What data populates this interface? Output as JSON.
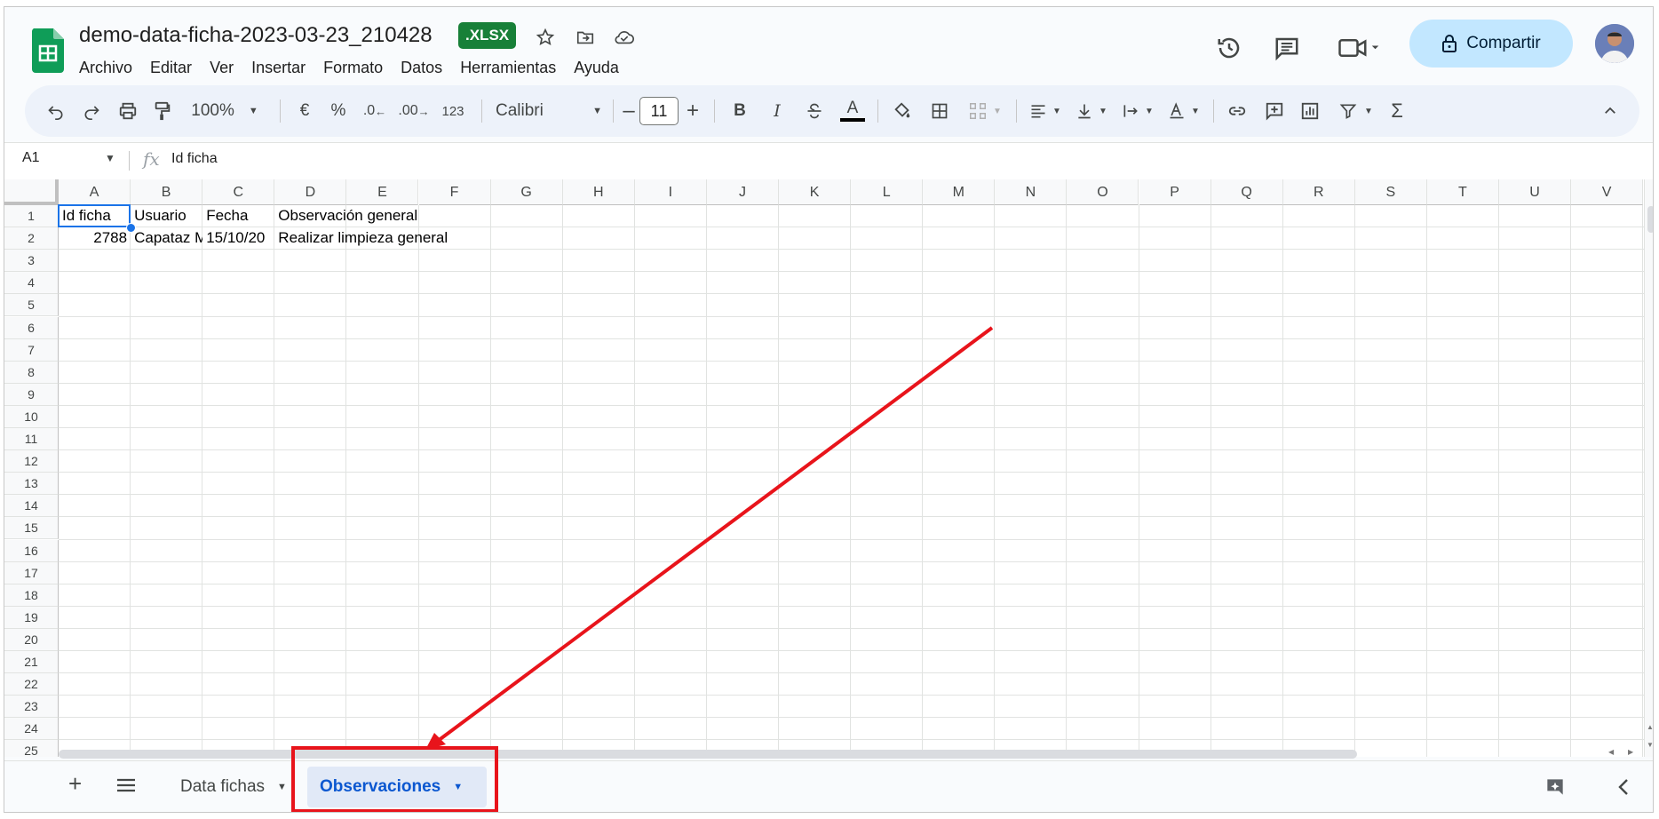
{
  "document": {
    "title": "demo-data-ficha-2023-03-23_210428",
    "format_badge": ".XLSX"
  },
  "menu": [
    "Archivo",
    "Editar",
    "Ver",
    "Insertar",
    "Formato",
    "Datos",
    "Herramientas",
    "Ayuda"
  ],
  "header": {
    "share_label": "Compartir",
    "icons": [
      "history-icon",
      "comment-icon",
      "meet-icon",
      "lock-icon",
      "avatar"
    ]
  },
  "toolbar": {
    "zoom": "100%",
    "currency": "€",
    "percent": "%",
    "decrease_decimals": ".0",
    "increase_decimals": ".00",
    "number_format": "123",
    "font_family": "Calibri",
    "font_size": "11",
    "bold": "B",
    "italic": "I",
    "text_color": "A"
  },
  "formula_bar": {
    "cell_ref": "A1",
    "fx_symbol": "fx",
    "value": "Id ficha"
  },
  "columns": [
    "A",
    "B",
    "C",
    "D",
    "E",
    "F",
    "G",
    "H",
    "I",
    "J",
    "K",
    "L",
    "M",
    "N",
    "O",
    "P",
    "Q",
    "R",
    "S",
    "T",
    "U",
    "V"
  ],
  "rows": [
    "1",
    "2",
    "3",
    "4",
    "5",
    "6",
    "7",
    "8",
    "9",
    "10",
    "11",
    "12",
    "13",
    "14",
    "15",
    "16",
    "17",
    "18",
    "19",
    "20",
    "21",
    "22",
    "23",
    "24",
    "25"
  ],
  "cells": {
    "A1": "Id ficha",
    "B1": "Usuario",
    "C1": "Fecha",
    "D1": "Observación general",
    "A2": "2788",
    "B2": "Capataz M",
    "C2": "15/10/20",
    "D2": "Realizar limpieza general"
  },
  "sheets": {
    "add_label": "+",
    "tabs": [
      {
        "label": "Data fichas",
        "active": false
      },
      {
        "label": "Observaciones",
        "active": true
      }
    ]
  },
  "colors": {
    "accent": "#0b57d0",
    "share_bg": "#c2e7ff",
    "badge_green": "#188038",
    "annotation_red": "#e8141b"
  }
}
